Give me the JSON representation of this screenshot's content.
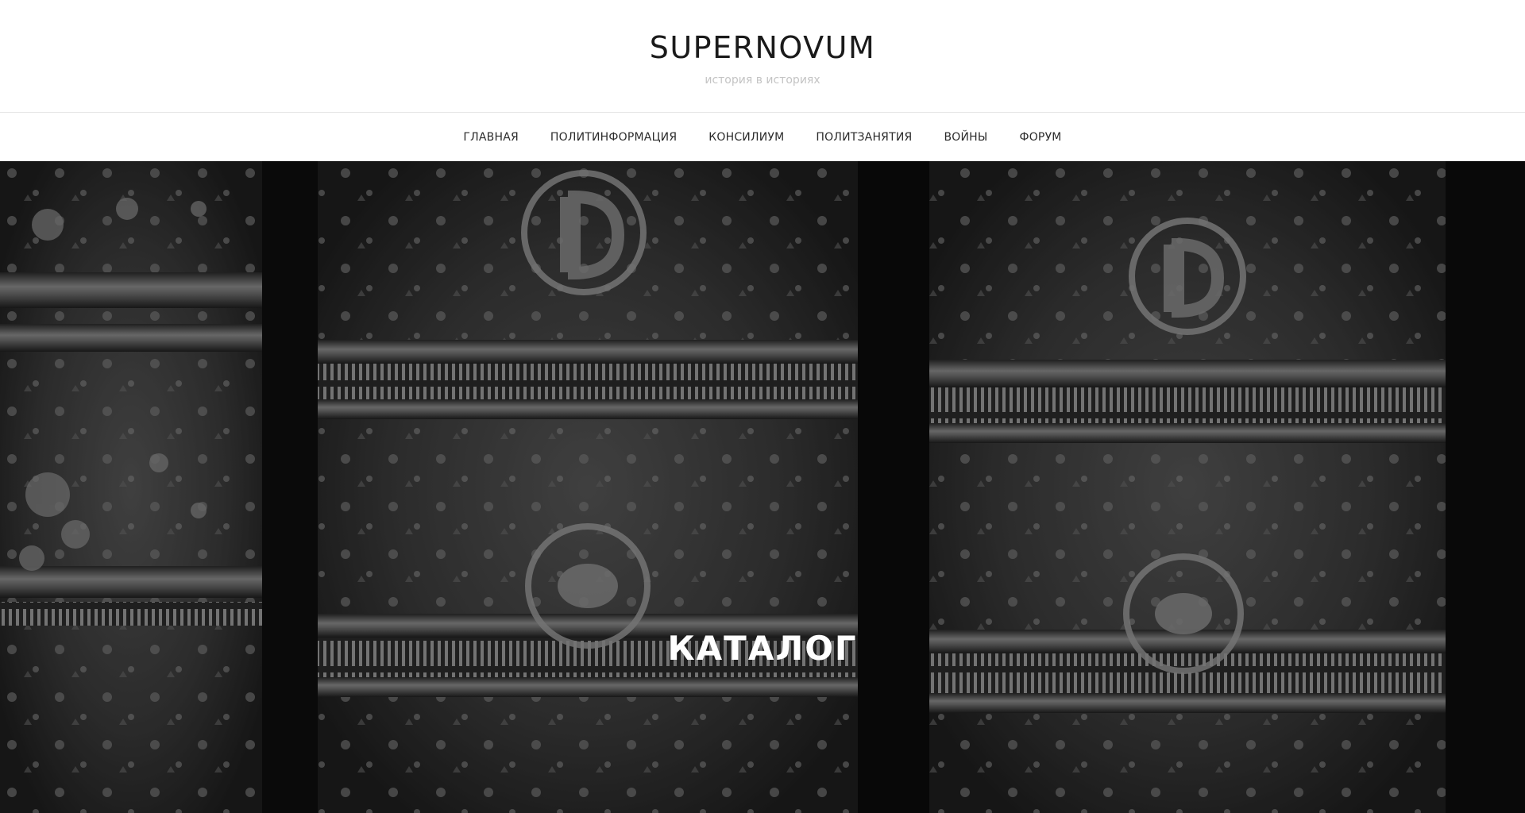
{
  "site": {
    "title": "SUPERNOVUM",
    "tagline": "история в историях"
  },
  "nav": {
    "items": [
      {
        "label": "ГЛАВНАЯ"
      },
      {
        "label": "ПОЛИТИНФОРМАЦИЯ"
      },
      {
        "label": "КОНСИЛИУМ"
      },
      {
        "label": "ПОЛИТЗАНЯТИЯ"
      },
      {
        "label": "ВОЙНЫ"
      },
      {
        "label": "ФОРУМ"
      }
    ]
  },
  "hero": {
    "title": "КАТАЛОГ"
  },
  "colors": {
    "background": "#ffffff",
    "title_text": "#1a1a1a",
    "tagline_text": "#c4c4c4",
    "nav_text": "#2b2b2b",
    "hero_overlay_text": "#ffffff"
  }
}
